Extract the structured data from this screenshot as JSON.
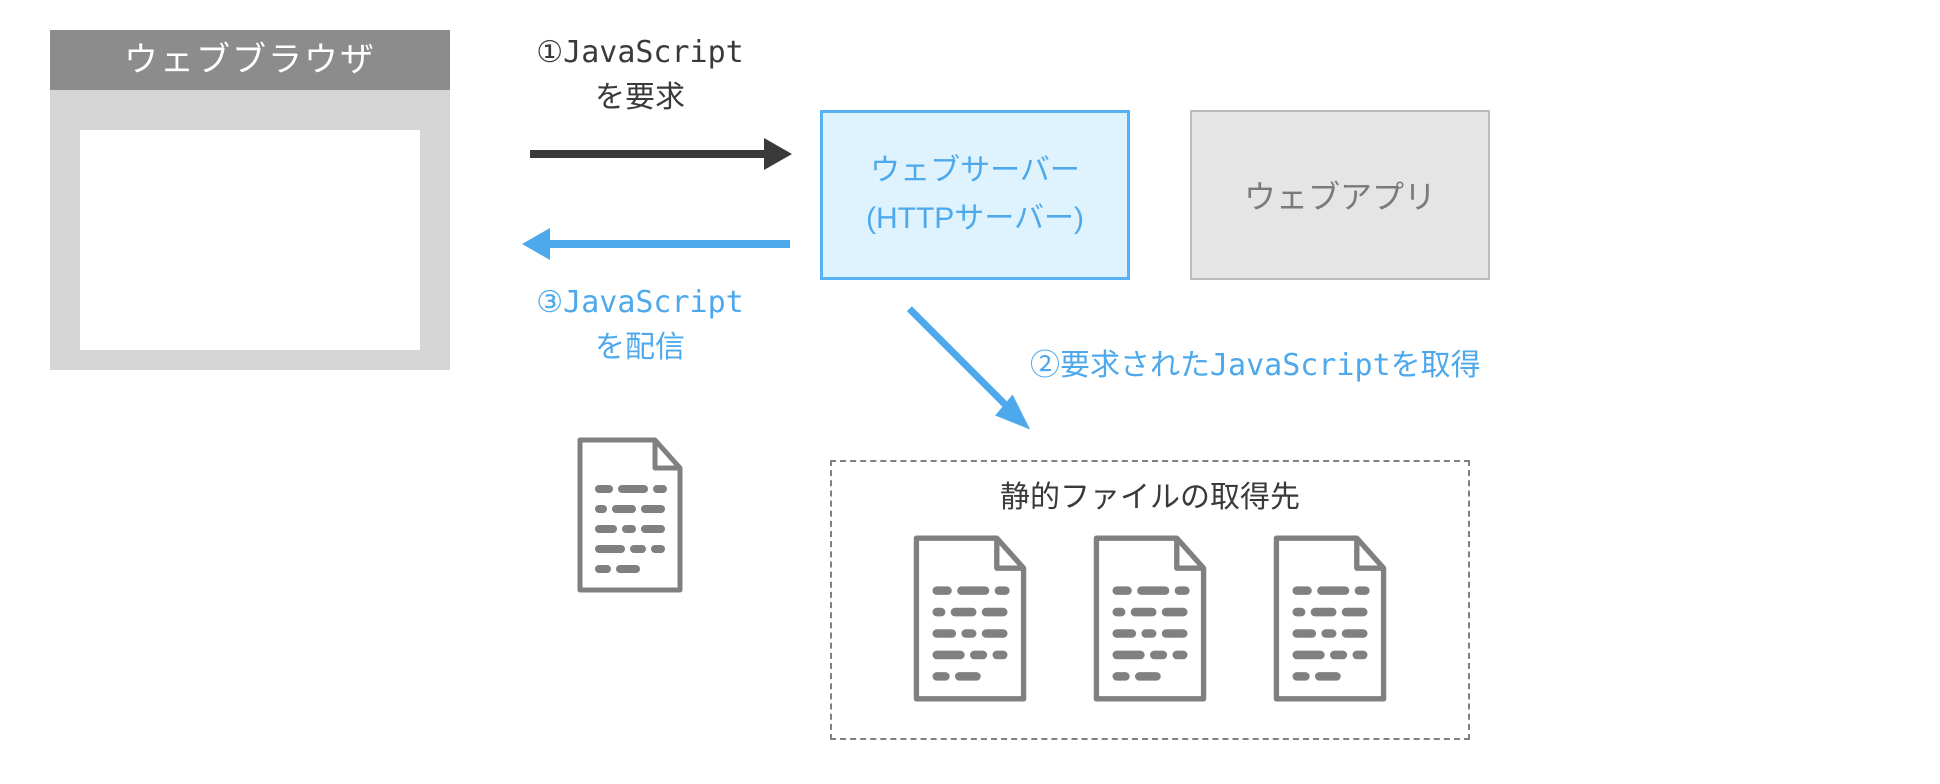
{
  "browser": {
    "title": "ウェブブラウザ"
  },
  "webserver": {
    "line1": "ウェブサーバー",
    "line2": "(HTTPサーバー)"
  },
  "webapp": {
    "label": "ウェブアプリ"
  },
  "steps": {
    "s1_line1": "①JavaScript",
    "s1_line2": "を要求",
    "s2": "②要求されたJavaScriptを取得",
    "s3_line1": "③JavaScript",
    "s3_line2": "を配信"
  },
  "static": {
    "title": "静的ファイルの取得先"
  }
}
